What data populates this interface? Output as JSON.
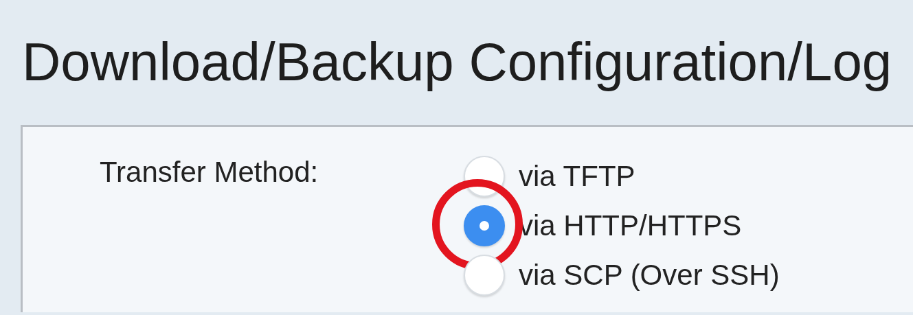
{
  "page": {
    "title": "Download/Backup Configuration/Log"
  },
  "transfer_method": {
    "label": "Transfer Method:",
    "options": [
      {
        "label": "via TFTP",
        "selected": false,
        "highlighted": false
      },
      {
        "label": "via HTTP/HTTPS",
        "selected": true,
        "highlighted": true
      },
      {
        "label": "via SCP (Over SSH)",
        "selected": false,
        "highlighted": false
      }
    ]
  }
}
